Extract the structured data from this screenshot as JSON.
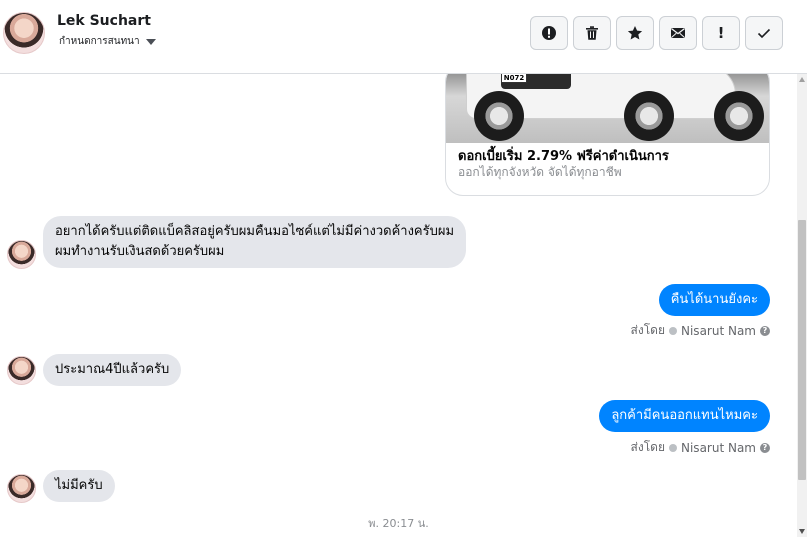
{
  "header": {
    "contact_name": "Lek Suchart",
    "contact_sub": "กำหนดการสนทนา",
    "actions": [
      {
        "name": "spam-report-button",
        "icon": "alert-circle-icon"
      },
      {
        "name": "delete-button",
        "icon": "trash-icon"
      },
      {
        "name": "star-button",
        "icon": "star-icon"
      },
      {
        "name": "mark-unread-button",
        "icon": "envelope-icon"
      },
      {
        "name": "follow-up-button",
        "icon": "exclamation-icon",
        "label": "!"
      },
      {
        "name": "mark-done-button",
        "icon": "check-icon"
      }
    ]
  },
  "card": {
    "plate": "N072",
    "title": "ดอกเบี้ยเริ่ม 2.79% ฟรีค่าดำเนินการ",
    "subtitle": "ออกได้ทุกจังหวัด จัดได้ทุกอาชีพ"
  },
  "messages": [
    {
      "side": "in",
      "lines": [
        "อยากได้ครับแต่ติดแบ็คลิสอยู่ครับผมคืนมอไซค์แต่ไม่มีค่างวดค้างครับผม",
        "ผมทำงานรับเงินสดด้วยครับผม"
      ]
    },
    {
      "side": "out",
      "text": "คืนได้นานยังคะ",
      "sent_by_label": "ส่งโดย",
      "sender": "Nisarut Nam"
    },
    {
      "side": "in",
      "text": "ประมาณ4ปีแล้วครับ"
    },
    {
      "side": "out",
      "text": "ลูกค้ามีคนออกแทนไหมคะ",
      "sent_by_label": "ส่งโดย",
      "sender": "Nisarut Nam"
    },
    {
      "side": "in",
      "text": "ไม่มีครับ"
    }
  ],
  "timestamp": "พ. 20:17 น.",
  "colors": {
    "outgoing": "#0084ff",
    "incoming": "#e4e6eb"
  }
}
